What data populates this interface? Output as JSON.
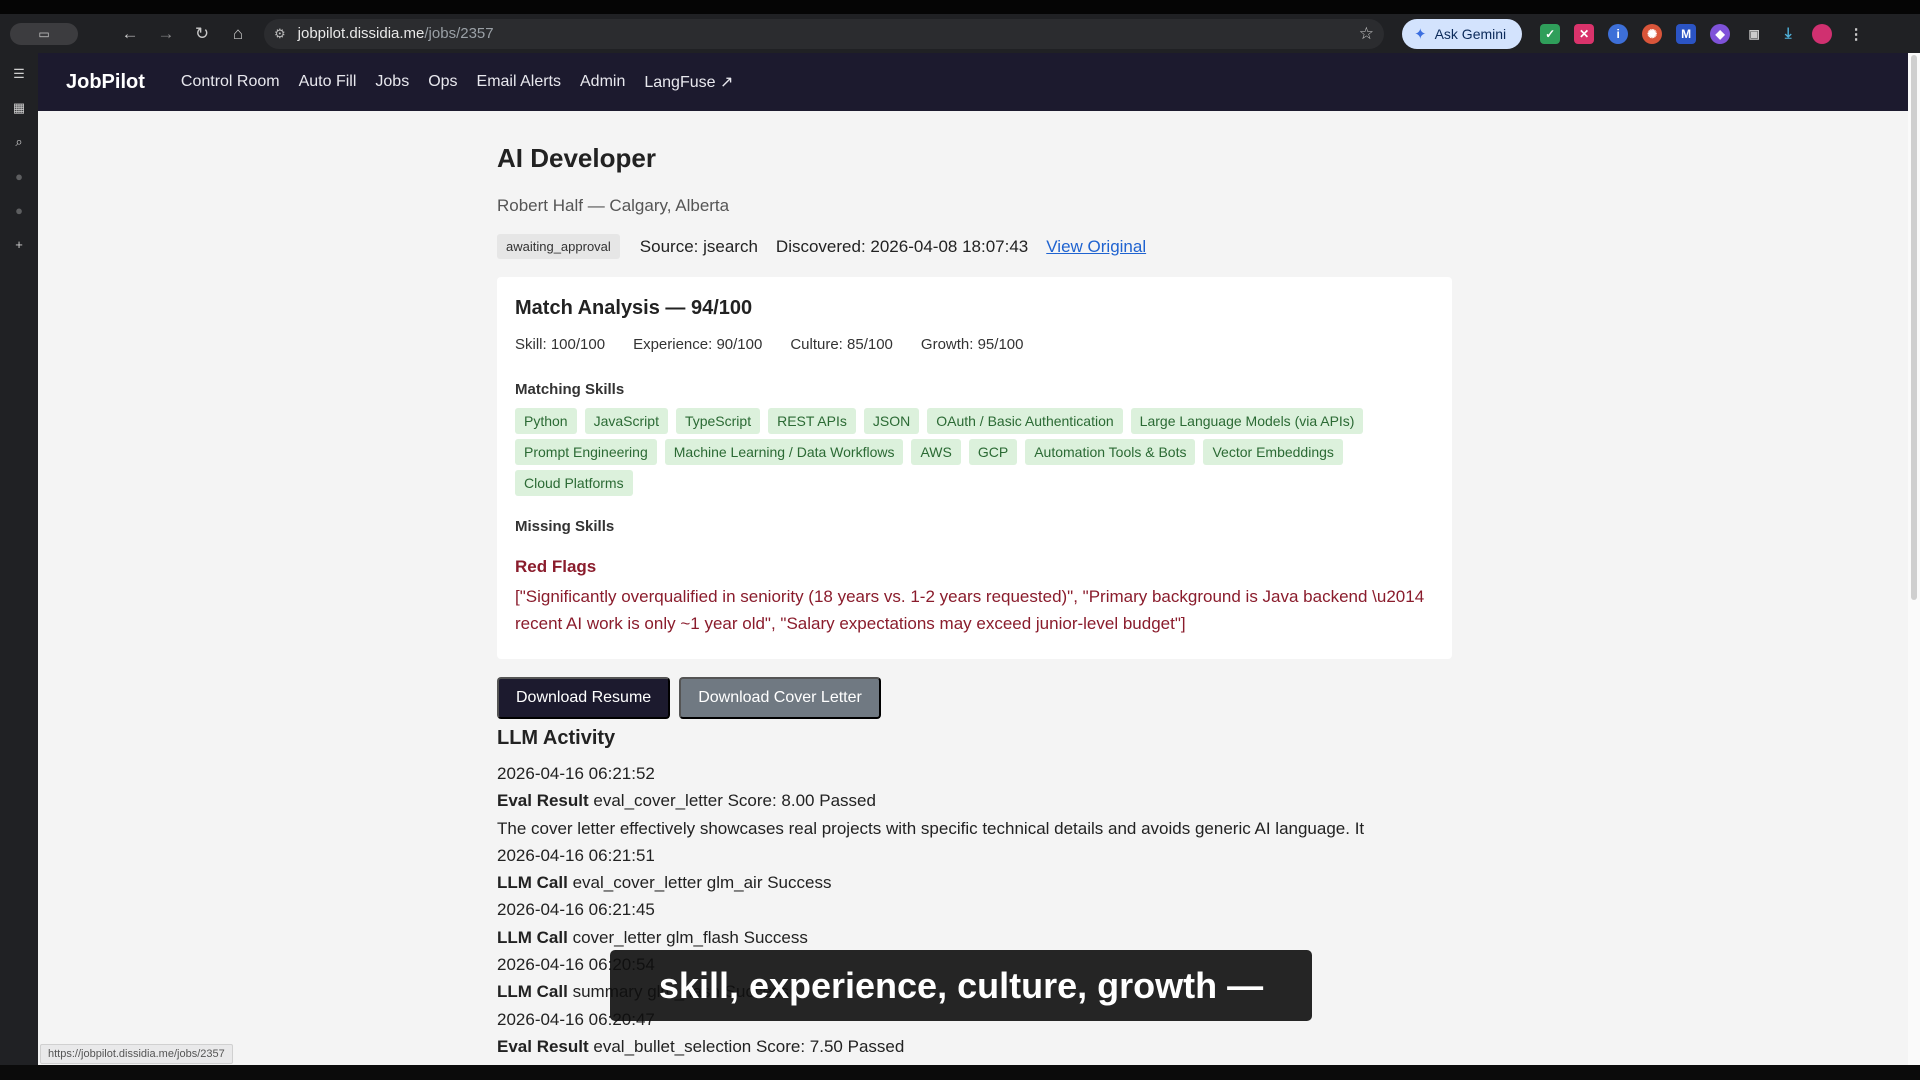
{
  "browser": {
    "url_host": "jobpilot.dissidia.me",
    "url_path": "/jobs/2357",
    "gemini_label": "Ask Gemini",
    "status_url": "https://jobpilot.dissidia.me/jobs/2357"
  },
  "nav": {
    "brand": "JobPilot",
    "links": [
      "Control Room",
      "Auto Fill",
      "Jobs",
      "Ops",
      "Email Alerts",
      "Admin",
      "LangFuse ↗"
    ]
  },
  "job": {
    "title": "AI Developer",
    "company_location": "Robert Half — Calgary, Alberta",
    "status": "awaiting_approval",
    "source": "Source: jsearch",
    "discovered": "Discovered: 2026-04-08 18:07:43",
    "view_original": "View Original"
  },
  "match": {
    "title": "Match Analysis — 94/100",
    "scores": [
      "Skill: 100/100",
      "Experience: 90/100",
      "Culture: 85/100",
      "Growth: 95/100"
    ],
    "matching_heading": "Matching Skills",
    "matching_skills": [
      "Python",
      "JavaScript",
      "TypeScript",
      "REST APIs",
      "JSON",
      "OAuth / Basic Authentication",
      "Large Language Models (via APIs)",
      "Prompt Engineering",
      "Machine Learning / Data Workflows",
      "AWS",
      "GCP",
      "Automation Tools & Bots",
      "Vector Embeddings",
      "Cloud Platforms"
    ],
    "missing_heading": "Missing Skills",
    "red_flags_heading": "Red Flags",
    "red_flags_text": "[\"Significantly overqualified in seniority (18 years vs. 1-2 years requested)\", \"Primary background is Java backend \\u2014 recent AI work is only ~1 year old\", \"Salary expectations may exceed junior-level budget\"]"
  },
  "actions": {
    "download_resume": "Download Resume",
    "download_cover_letter": "Download Cover Letter"
  },
  "llm": {
    "heading": "LLM Activity",
    "entries": [
      {
        "time": "2026-04-16 06:21:52",
        "kind": "Eval Result",
        "detail": "eval_cover_letter Score: 8.00 Passed",
        "note": "The cover letter effectively showcases real projects with specific technical details and avoids generic AI language. It"
      },
      {
        "time": "2026-04-16 06:21:51",
        "kind": "LLM Call",
        "detail": "eval_cover_letter glm_air Success"
      },
      {
        "time": "2026-04-16 06:21:45",
        "kind": "LLM Call",
        "detail": "cover_letter glm_flash Success"
      },
      {
        "time": "2026-04-16 06:20:54",
        "kind": "LLM Call",
        "detail": "summary glm_flash Success"
      },
      {
        "time": "2026-04-16 06:20:47",
        "kind": "Eval Result",
        "detail": "eval_bullet_selection Score: 7.50 Passed"
      }
    ]
  },
  "caption": "skill, experience, culture, growth —"
}
